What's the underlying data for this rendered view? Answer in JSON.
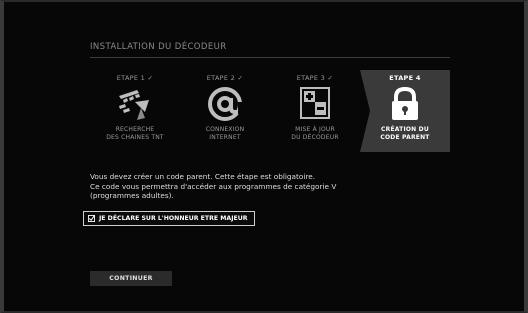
{
  "header": {
    "title": "INSTALLATION DU DÉCODEUR"
  },
  "steps": [
    {
      "label": "ETAPE 1 ✓",
      "desc": "RECHERCHE\nDES CHAINES TNT",
      "icon": "satellite-dish-icon"
    },
    {
      "label": "ETAPE 2 ✓",
      "desc": "CONNEXION\nINTERNET",
      "icon": "at-sign-icon"
    },
    {
      "label": "ETAPE 3 ✓",
      "desc": "MISE À JOUR\nDU DÉCODEUR",
      "icon": "update-icon"
    },
    {
      "label": "ETAPE 4",
      "desc": "CRÉATION DU\nCODE PARENT",
      "icon": "padlock-icon",
      "active": true
    }
  ],
  "message": {
    "line1": "Vous devez créer un code parent. Cette étape est obligatoire.",
    "line2": "Ce code vous permettra d'accéder aux programmes de catégorie V",
    "line3": "(programmes adultes)."
  },
  "declare": {
    "label": "JE DÉCLARE SUR L'HONNEUR ETRE MAJEUR",
    "checked": true
  },
  "continue": {
    "label": "CONTINUER"
  },
  "colors": {
    "background": "#070707",
    "active_step": "#3a3a3a",
    "frame": "#3a3a3a"
  }
}
